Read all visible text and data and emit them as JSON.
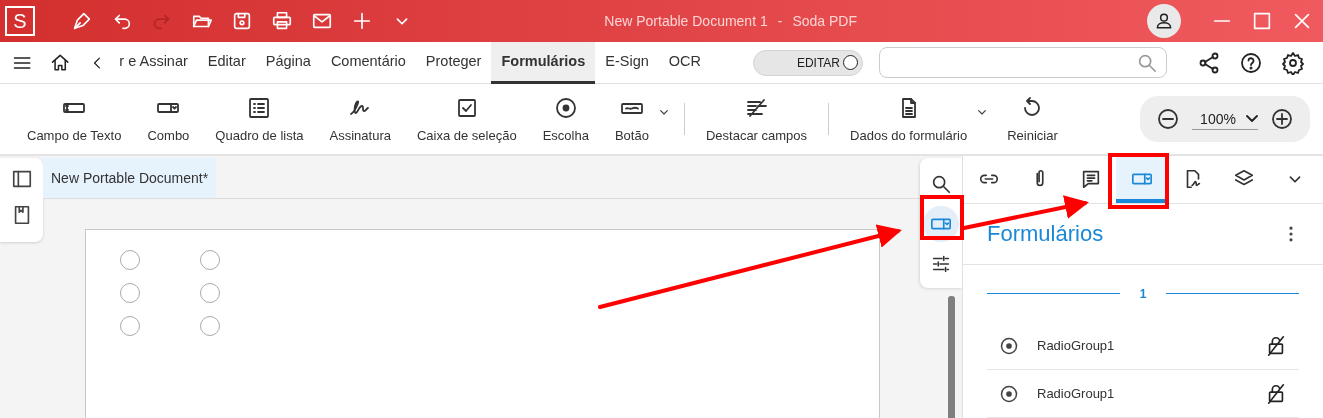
{
  "window": {
    "logo": "S",
    "title": "New Portable Document 1",
    "app_name": "Soda PDF",
    "separator": "-"
  },
  "quick_tools": [
    {
      "kind": "pen",
      "disabled": false
    },
    {
      "kind": "undo",
      "disabled": false
    },
    {
      "kind": "redo",
      "disabled": true
    },
    {
      "kind": "open",
      "disabled": false
    },
    {
      "kind": "save",
      "disabled": false
    },
    {
      "kind": "print",
      "disabled": false
    },
    {
      "kind": "mail",
      "disabled": false
    },
    {
      "kind": "plus",
      "disabled": false
    },
    {
      "kind": "caret",
      "disabled": false
    }
  ],
  "menu_tabs": [
    {
      "label": "r e Assinar",
      "selected": false
    },
    {
      "label": "Editar",
      "selected": false
    },
    {
      "label": "Página",
      "selected": false
    },
    {
      "label": "Comentário",
      "selected": false
    },
    {
      "label": "Proteger",
      "selected": false
    },
    {
      "label": "Formulários",
      "selected": true
    },
    {
      "label": "E-Sign",
      "selected": false
    },
    {
      "label": "OCR",
      "selected": false
    }
  ],
  "edit_toggle": {
    "label": "EDITAR",
    "on": false
  },
  "ribbon": [
    {
      "kind": "textfield",
      "label": "Campo de Texto",
      "has_menu": false,
      "divider_before": false
    },
    {
      "kind": "combo",
      "label": "Combo",
      "has_menu": false,
      "divider_before": false
    },
    {
      "kind": "listbox",
      "label": "Quadro de lista",
      "has_menu": false,
      "divider_before": false
    },
    {
      "kind": "signature",
      "label": "Assinatura",
      "has_menu": false,
      "divider_before": false
    },
    {
      "kind": "checkbox",
      "label": "Caixa de seleção",
      "has_menu": false,
      "divider_before": false
    },
    {
      "kind": "radio",
      "label": "Escolha",
      "has_menu": false,
      "divider_before": false
    },
    {
      "kind": "button",
      "label": "Botão",
      "has_menu": true,
      "divider_before": false
    },
    {
      "kind": "highlight",
      "label": "Destacar campos",
      "has_menu": false,
      "divider_before": true
    },
    {
      "kind": "formdata",
      "label": "Dados do formulário",
      "has_menu": true,
      "divider_before": true
    },
    {
      "kind": "reset",
      "label": "Reiniciar",
      "has_menu": false,
      "divider_before": false
    }
  ],
  "zoom": {
    "value": "100%"
  },
  "document_tab": {
    "label": "New Portable Document*",
    "selected": true
  },
  "page_radios": [
    {
      "selected": false
    },
    {
      "selected": false
    },
    {
      "selected": false
    },
    {
      "selected": false
    },
    {
      "selected": false
    },
    {
      "selected": false
    }
  ],
  "side_rail": [
    {
      "kind": "search",
      "selected": false
    },
    {
      "kind": "forms",
      "selected": true
    },
    {
      "kind": "properties",
      "selected": false
    }
  ],
  "panel_tabs": [
    {
      "kind": "link",
      "selected": false
    },
    {
      "kind": "attachment",
      "selected": false
    },
    {
      "kind": "comment",
      "selected": false
    },
    {
      "kind": "forms",
      "selected": true
    },
    {
      "kind": "signature",
      "selected": false
    },
    {
      "kind": "layers",
      "selected": false
    },
    {
      "kind": "more",
      "selected": false
    }
  ],
  "panel": {
    "title": "Formulários",
    "page_label": "1",
    "fields": [
      {
        "kind": "radio",
        "name": "RadioGroup1"
      },
      {
        "kind": "radio",
        "name": "RadioGroup1"
      }
    ]
  }
}
